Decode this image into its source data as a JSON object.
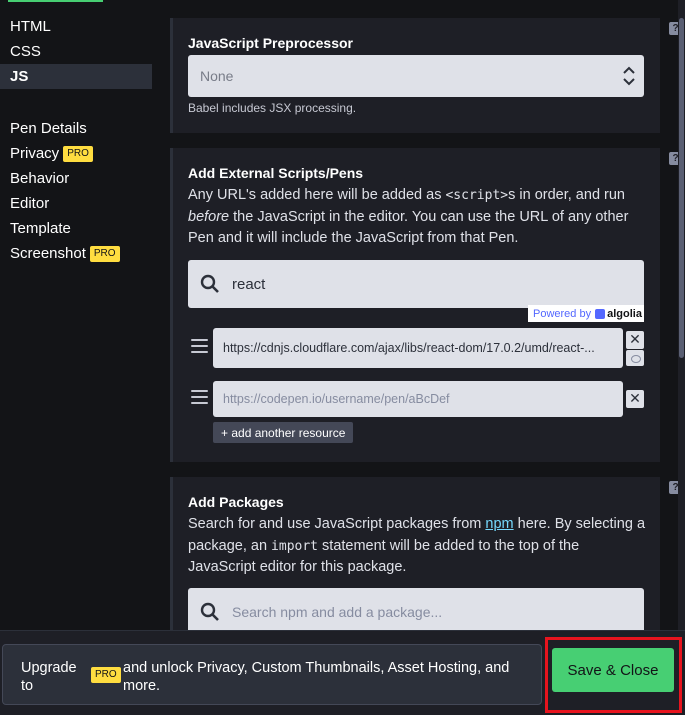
{
  "sidebar": {
    "languages": [
      {
        "label": "HTML",
        "active": false
      },
      {
        "label": "CSS",
        "active": false
      },
      {
        "label": "JS",
        "active": true
      }
    ],
    "settings": [
      {
        "label": "Pen Details",
        "pro": false
      },
      {
        "label": "Privacy",
        "pro": true
      },
      {
        "label": "Behavior",
        "pro": false
      },
      {
        "label": "Editor",
        "pro": false
      },
      {
        "label": "Template",
        "pro": false
      },
      {
        "label": "Screenshot",
        "pro": true
      }
    ],
    "pro_badge": "PRO"
  },
  "preprocessor": {
    "title": "JavaScript Preprocessor",
    "selected": "None",
    "help": "Babel includes JSX processing.",
    "help_icon": "?"
  },
  "external": {
    "title": "Add External Scripts/Pens",
    "desc_part1": "Any URL's added here will be added as ",
    "desc_code": "<script>",
    "desc_part2": "s in order, and run ",
    "desc_em": "before",
    "desc_part3": " the JavaScript in the editor. You can use the URL of any other Pen and it will include the JavaScript from that Pen.",
    "search_value": "react",
    "powered_by": "Powered by",
    "algolia": "algolia",
    "resources": [
      {
        "value": "https://cdnjs.cloudflare.com/ajax/libs/react-dom/17.0.2/umd/react-...",
        "placeholder": ""
      },
      {
        "value": "",
        "placeholder": "https://codepen.io/username/pen/aBcDef"
      }
    ],
    "close_glyph": "✕",
    "add_resource": "+ add another resource"
  },
  "packages": {
    "title": "Add Packages",
    "desc_part1": "Search for and use JavaScript packages from ",
    "desc_link": "npm",
    "desc_part2": " here. By selecting a package, an ",
    "desc_code": "import",
    "desc_part3": " statement will be added to the top of the JavaScript editor for this package.",
    "search_placeholder": "Search npm and add a package..."
  },
  "footer": {
    "upgrade_label": "Upgrade to",
    "pro_badge": "PRO",
    "upgrade_text": "and unlock Privacy, Custom Thumbnails, Asset Hosting, and more.",
    "save_label": "Save & Close"
  },
  "colors": {
    "accent": "#47cf73",
    "pro": "#ffdd40",
    "highlight_border": "#e8141e"
  }
}
